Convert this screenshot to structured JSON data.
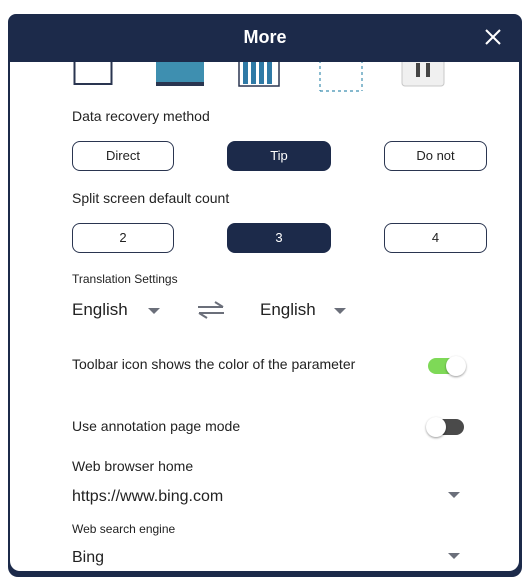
{
  "header": {
    "title": "More"
  },
  "colors": {
    "header_bg": "#1c2a4a",
    "toggle_on": "#7ed957",
    "toggle_off": "#4a4a4a"
  },
  "style_icons": [
    "square-outline-icon",
    "filled-rect-icon",
    "striped-rect-icon",
    "dashed-rect-icon",
    "pause-box-icon"
  ],
  "data_recovery": {
    "label": "Data recovery method",
    "options": [
      "Direct",
      "Tip",
      "Do not"
    ],
    "selected": "Tip"
  },
  "split_screen": {
    "label": "Split screen default count",
    "options": [
      "2",
      "3",
      "4"
    ],
    "selected": "3"
  },
  "translation": {
    "label": "Translation Settings",
    "source": "English",
    "target": "English"
  },
  "toolbar_color": {
    "label": "Toolbar icon shows the color of the parameter",
    "on": true
  },
  "annotation_mode": {
    "label": "Use annotation page mode",
    "on": false
  },
  "browser_home": {
    "label": "Web browser home",
    "value": "https://www.bing.com"
  },
  "search_engine": {
    "label": "Web search engine",
    "value": "Bing"
  }
}
